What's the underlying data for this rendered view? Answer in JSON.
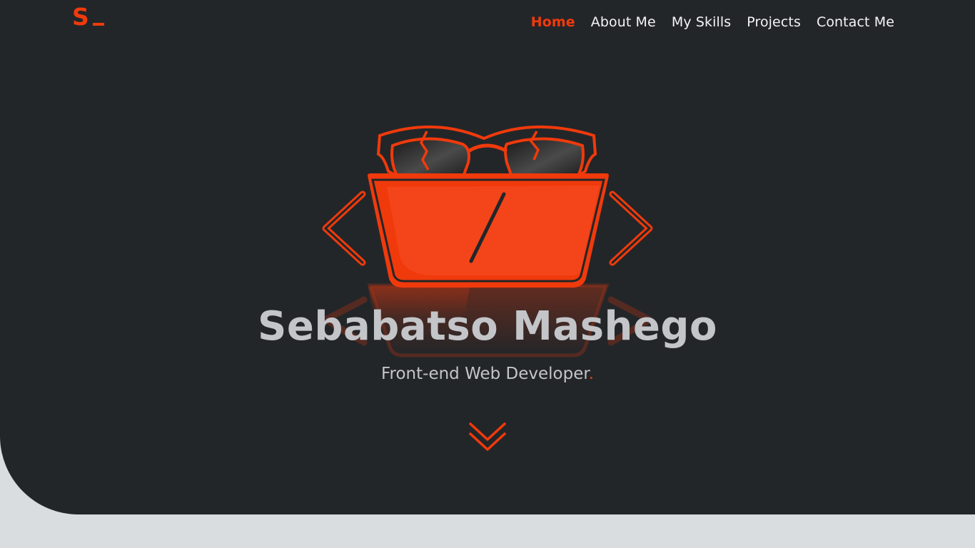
{
  "brand": {
    "logo_text": "S",
    "accent_color": "#f03a0c"
  },
  "nav": {
    "items": [
      {
        "label": "Home",
        "active": true
      },
      {
        "label": "About Me",
        "active": false
      },
      {
        "label": "My Skills",
        "active": false
      },
      {
        "label": "Projects",
        "active": false
      },
      {
        "label": "Contact Me",
        "active": false
      }
    ]
  },
  "hero": {
    "name": "Sebabatso Mashego",
    "role": "Front-end Web Developer",
    "role_suffix": ".",
    "illustration_icon": "laptop-with-sunglasses-icon",
    "scroll_icon": "double-chevron-down-icon",
    "background_color": "#232629",
    "page_color": "#d9dde0"
  }
}
